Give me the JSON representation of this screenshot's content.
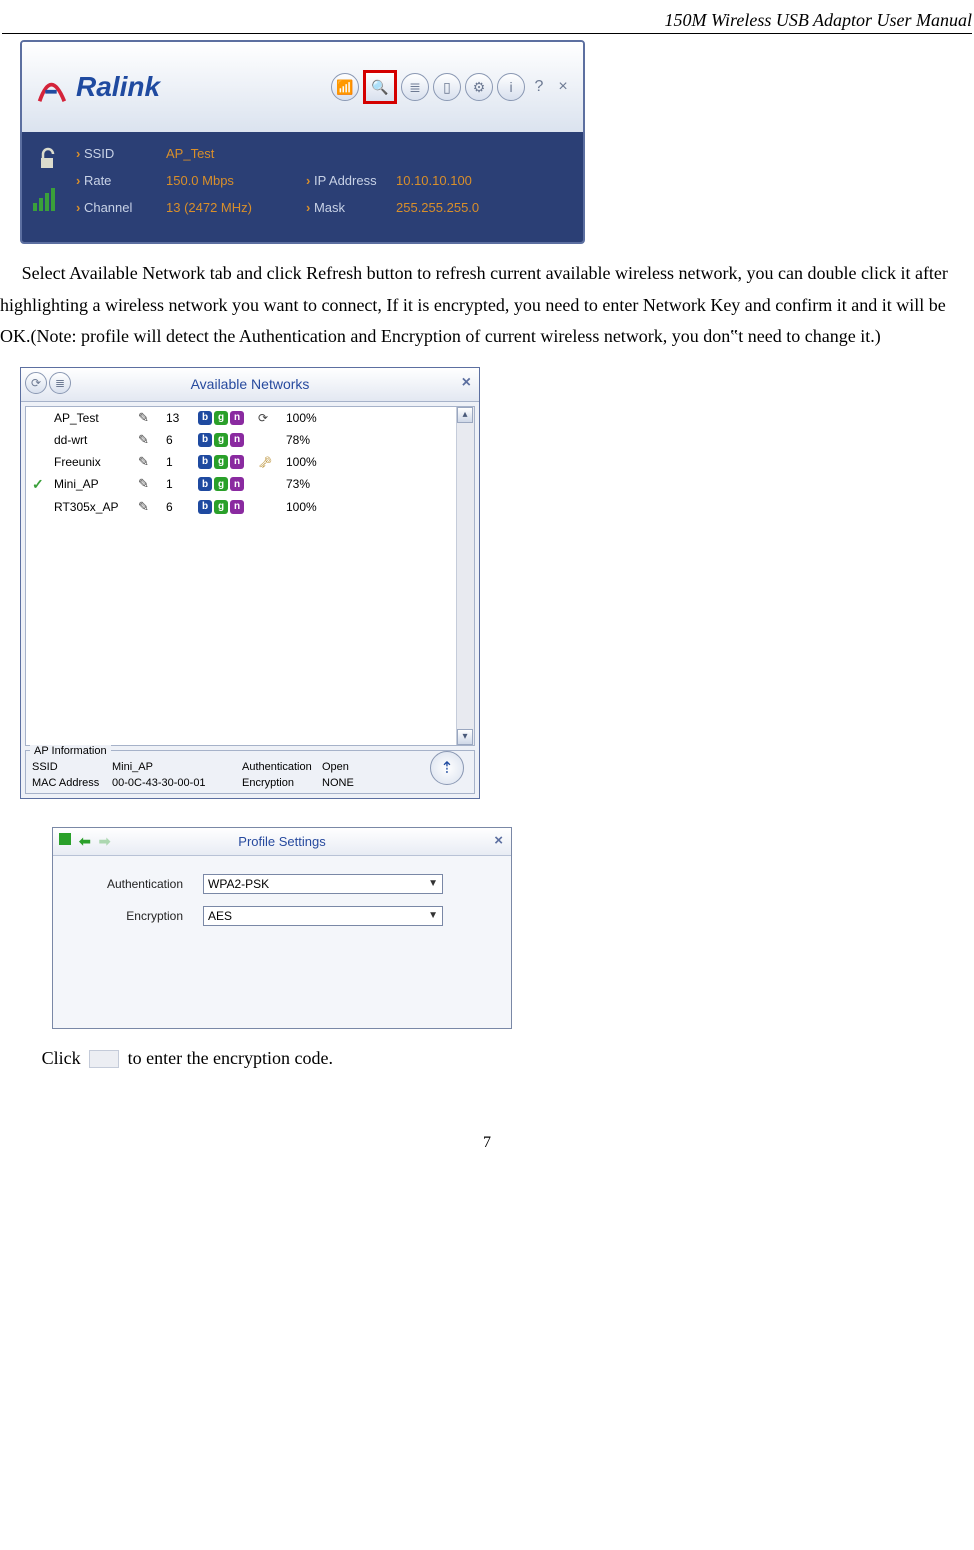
{
  "header": {
    "title": "150M Wireless USB Adaptor User Manual"
  },
  "ralink": {
    "brand": "Ralink",
    "rows": {
      "ssid_label": "SSID",
      "ssid_value": "AP_Test",
      "rate_label": "Rate",
      "rate_value": "150.0 Mbps",
      "channel_label": "Channel",
      "channel_value": "13 (2472 MHz)",
      "ip_label": "IP Address",
      "ip_value": "10.10.10.100",
      "mask_label": "Mask",
      "mask_value": "255.255.255.0"
    }
  },
  "para1": "Select Available Network tab and click Refresh button to refresh current available wireless network, you can double click it after highlighting a wireless network you want to connect, If it is encrypted, you need to enter Network Key and confirm it and it will be OK.(Note: profile will detect the Authentication and Encryption of current wireless network, you don‟t need to change it.)",
  "networks": {
    "title": "Available Networks",
    "rows": [
      {
        "ssid": "AP_Test",
        "ch": "13",
        "badges": [
          "b",
          "g",
          "n"
        ],
        "lock": false,
        "extra": "refresh",
        "signal": "100%",
        "connected": false
      },
      {
        "ssid": "dd-wrt",
        "ch": "6",
        "badges": [
          "b",
          "g",
          "n"
        ],
        "lock": false,
        "extra": "",
        "signal": "78%",
        "connected": false
      },
      {
        "ssid": "Freeunix",
        "ch": "1",
        "badges": [
          "b",
          "g",
          "n"
        ],
        "lock": true,
        "extra": "",
        "signal": "100%",
        "connected": false
      },
      {
        "ssid": "Mini_AP",
        "ch": "1",
        "badges": [
          "b",
          "g",
          "n"
        ],
        "lock": false,
        "extra": "",
        "signal": "73%",
        "connected": true
      },
      {
        "ssid": "RT305x_AP",
        "ch": "6",
        "badges": [
          "b",
          "g",
          "n"
        ],
        "lock": false,
        "extra": "",
        "signal": "100%",
        "connected": false
      }
    ],
    "ap_info": {
      "legend": "AP Information",
      "ssid_label": "SSID",
      "ssid_value": "Mini_AP",
      "mac_label": "MAC Address",
      "mac_value": "00-0C-43-30-00-01",
      "auth_label": "Authentication",
      "auth_value": "Open",
      "enc_label": "Encryption",
      "enc_value": "NONE"
    }
  },
  "profile": {
    "title": "Profile Settings",
    "auth_label": "Authentication",
    "auth_value": "WPA2-PSK",
    "enc_label": "Encryption",
    "enc_value": "AES"
  },
  "para2_pre": "Click",
  "para2_post": " to enter the encryption code.",
  "page_number": "7"
}
